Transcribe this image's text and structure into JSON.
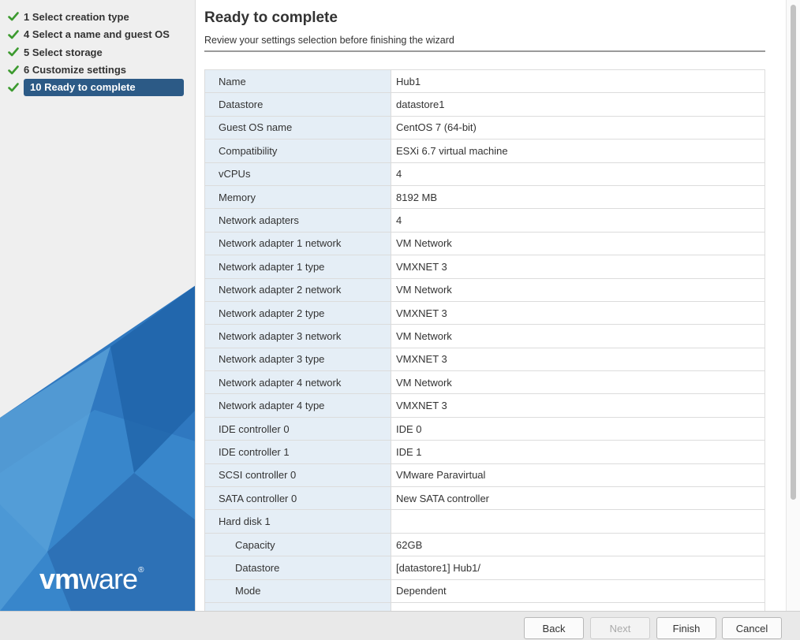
{
  "sidebar": {
    "steps": [
      {
        "label": "1 Select creation type",
        "done": true
      },
      {
        "label": "4 Select a name and guest OS",
        "done": true
      },
      {
        "label": "5 Select storage",
        "done": true
      },
      {
        "label": "6 Customize settings",
        "done": true
      },
      {
        "label": "10 Ready to complete",
        "done": true,
        "active": true
      }
    ],
    "logo": {
      "bold": "vm",
      "rest": "ware",
      "mark": "®"
    }
  },
  "header": {
    "title": "Ready to complete",
    "subtitle": "Review your settings selection before finishing the wizard"
  },
  "summary": [
    {
      "key": "Name",
      "value": "Hub1"
    },
    {
      "key": "Datastore",
      "value": "datastore1"
    },
    {
      "key": "Guest OS name",
      "value": "CentOS 7 (64-bit)"
    },
    {
      "key": "Compatibility",
      "value": "ESXi 6.7 virtual machine"
    },
    {
      "key": "vCPUs",
      "value": "4"
    },
    {
      "key": "Memory",
      "value": "8192 MB"
    },
    {
      "key": "Network adapters",
      "value": "4"
    },
    {
      "key": "Network adapter 1 network",
      "value": "VM Network"
    },
    {
      "key": "Network adapter 1 type",
      "value": "VMXNET 3"
    },
    {
      "key": "Network adapter 2 network",
      "value": "VM Network"
    },
    {
      "key": "Network adapter 2 type",
      "value": "VMXNET 3"
    },
    {
      "key": "Network adapter 3 network",
      "value": "VM Network"
    },
    {
      "key": "Network adapter 3 type",
      "value": "VMXNET 3"
    },
    {
      "key": "Network adapter 4 network",
      "value": "VM Network"
    },
    {
      "key": "Network adapter 4 type",
      "value": "VMXNET 3"
    },
    {
      "key": "IDE controller 0",
      "value": "IDE 0"
    },
    {
      "key": "IDE controller 1",
      "value": "IDE 1"
    },
    {
      "key": "SCSI controller 0",
      "value": "VMware Paravirtual"
    },
    {
      "key": "SATA controller 0",
      "value": "New SATA controller"
    },
    {
      "key": "Hard disk 1",
      "value": ""
    },
    {
      "key": "Capacity",
      "value": "62GB",
      "indent": true
    },
    {
      "key": "Datastore",
      "value": "[datastore1] Hub1/",
      "indent": true
    },
    {
      "key": "Mode",
      "value": "Dependent",
      "indent": true
    },
    {
      "key": "",
      "value": "",
      "indent": true
    }
  ],
  "footer": {
    "back": "Back",
    "next": "Next",
    "finish": "Finish",
    "cancel": "Cancel"
  },
  "colors": {
    "check": "#3c9a2f",
    "active_step": "#2c5a86",
    "key_cell": "#e5eef6"
  }
}
